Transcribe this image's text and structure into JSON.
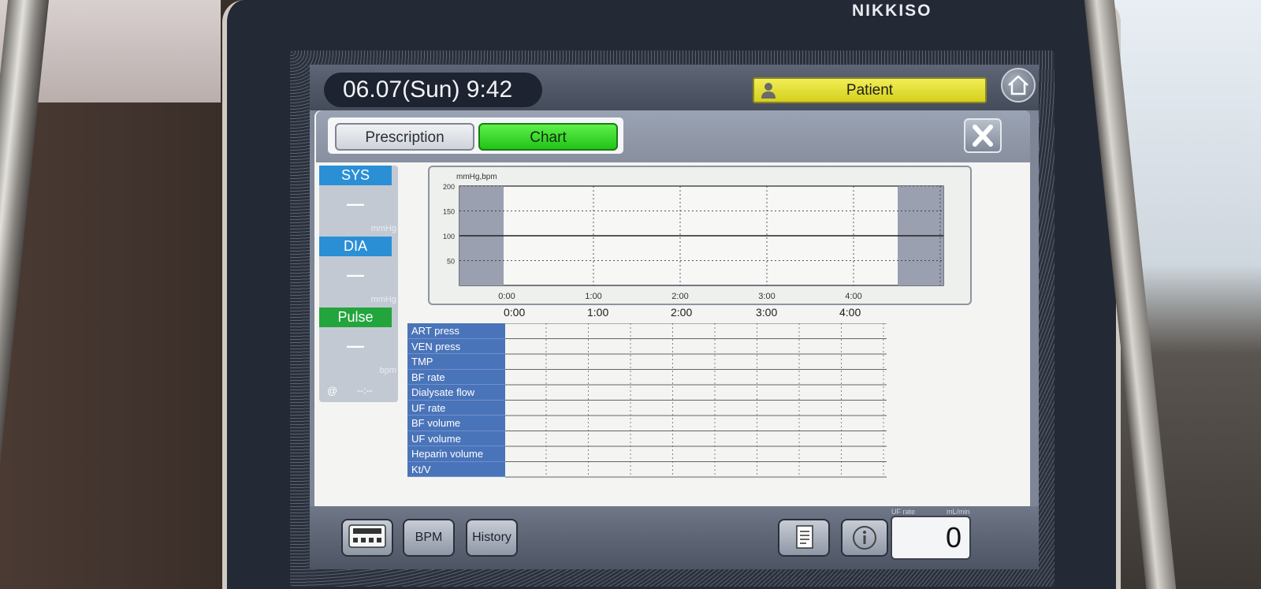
{
  "device": {
    "brand": "NIKKISO"
  },
  "header": {
    "datetime": "06.07(Sun)  9:42",
    "patient_label": "Patient"
  },
  "tabs": [
    {
      "label": "Prescription"
    },
    {
      "label": "Chart"
    }
  ],
  "vitals": {
    "sys": {
      "label": "SYS",
      "value": "—",
      "unit": "mmHg"
    },
    "dia": {
      "label": "DIA",
      "value": "—",
      "unit": "mmHg"
    },
    "pulse": {
      "label": "Pulse",
      "value": "—",
      "unit": "bpm"
    },
    "at_symbol": "@",
    "time": "--:--"
  },
  "chart_data": {
    "type": "line",
    "ylabel": "mmHg,bpm",
    "y_ticks": [
      "200",
      "150",
      "100",
      "50"
    ],
    "x_ticks": [
      "0:00",
      "1:00",
      "2:00",
      "3:00",
      "4:00"
    ],
    "ylim": [
      0,
      200
    ],
    "series": []
  },
  "table": {
    "time_headers": [
      "0:00",
      "1:00",
      "2:00",
      "3:00",
      "4:00"
    ],
    "rows": [
      "ART press",
      "VEN press",
      "TMP",
      "BF rate",
      "Dialysate flow",
      "UF rate",
      "BF volume",
      "UF volume",
      "Heparin volume",
      "Kt/V"
    ]
  },
  "bottom": {
    "bpm_label": "BPM",
    "history_label": "History",
    "counter_value": "0",
    "counter_caption_left": "UF rate",
    "counter_caption_right": "mL/min"
  },
  "colors": {
    "chart_tab": "#21c418",
    "patient": "#e6e22f",
    "vital_blue": "#2b8fd6",
    "vital_green": "#22a53c"
  }
}
